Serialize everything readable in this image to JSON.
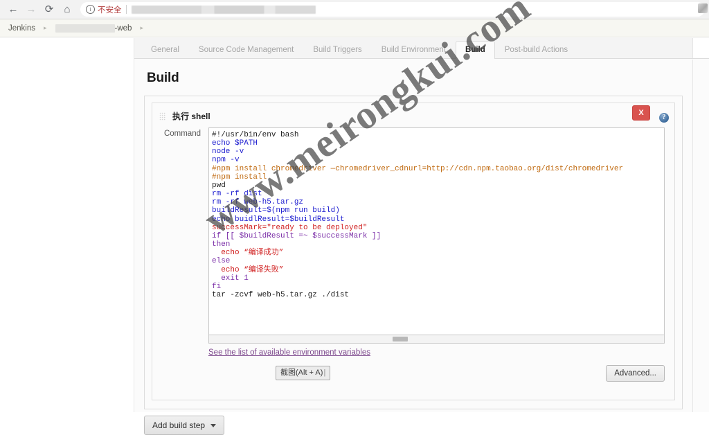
{
  "browser": {
    "back_icon": "back-arrow-icon",
    "forward_icon": "forward-arrow-icon",
    "reload_icon": "reload-icon",
    "home_icon": "home-icon",
    "info_glyph": "i",
    "security_label": "不安全",
    "url_value": "",
    "url_placeholder": ""
  },
  "breadcrumb": {
    "root": "Jenkins",
    "arrow": "▸",
    "job_suffix": "-web"
  },
  "tabs": [
    {
      "label": "General",
      "active": false
    },
    {
      "label": "Source Code Management",
      "active": false
    },
    {
      "label": "Build Triggers",
      "active": false
    },
    {
      "label": "Build Environment",
      "active": false
    },
    {
      "label": "Build",
      "active": true
    },
    {
      "label": "Post-build Actions",
      "active": false
    }
  ],
  "page": {
    "section_title": "Build",
    "step_title": "执行 shell",
    "close_label": "X",
    "help_label": "?",
    "command_label": "Command",
    "env_link": "See the list of available environment variables",
    "advanced_label": "Advanced...",
    "add_build_step_label": "Add build step",
    "tooltip_label": "截图(Alt + A)"
  },
  "script": {
    "lines": [
      {
        "text": "#!/usr/bin/env bash",
        "cls": "kw-plain"
      },
      {
        "text": "echo $PATH",
        "cls": "kw-blue"
      },
      {
        "text": "node -v",
        "cls": "kw-blue"
      },
      {
        "text": "npm -v",
        "cls": "kw-blue"
      },
      {
        "text": "#npm install chromedriver —chromedriver_cdnurl=http://cdn.npm.taobao.org/dist/chromedriver",
        "cls": "kw-comment"
      },
      {
        "text": "#npm install",
        "cls": "kw-comment"
      },
      {
        "text": "pwd",
        "cls": "kw-plain"
      },
      {
        "text": "rm -rf dist",
        "cls": "kw-blue"
      },
      {
        "text": "rm -rf web-h5.tar.gz",
        "cls": "kw-blue"
      },
      {
        "text": "buildResult=$(npm run build)",
        "cls": "kw-blue"
      },
      {
        "text": "echo buidlResult=$buildResult",
        "cls": "kw-blue"
      },
      {
        "text": "successMark=\"ready to be deployed\"",
        "cls": "kw-red"
      },
      {
        "text": "if [[ $buildResult =~ $successMark ]]",
        "cls": "kw-purple"
      },
      {
        "text": "then",
        "cls": "kw-purple"
      },
      {
        "text": "  echo “编译成功”",
        "cls": "kw-red"
      },
      {
        "text": "else",
        "cls": "kw-purple"
      },
      {
        "text": "  echo “编译失败”",
        "cls": "kw-red"
      },
      {
        "text": "  exit 1",
        "cls": "kw-purple"
      },
      {
        "text": "fi",
        "cls": "kw-purple"
      },
      {
        "text": "tar -zcvf web-h5.tar.gz ./dist",
        "cls": "kw-plain"
      }
    ]
  },
  "watermark": {
    "text": "www.meirongkui.com"
  },
  "colors": {
    "accent_red": "#d9534f",
    "link_purple": "#7e4a8e",
    "comment_orange": "#c06a10",
    "keyword_blue": "#2020d0",
    "string_red": "#d02020",
    "control_purple": "#7b2fa8",
    "breadcrumb_bg": "#f7f7f2"
  }
}
